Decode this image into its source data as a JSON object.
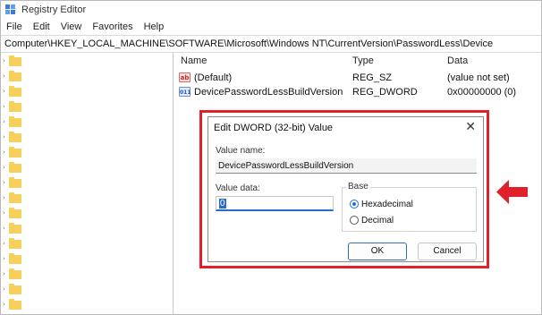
{
  "window": {
    "title": "Registry Editor",
    "app_icon": "registry-editor-icon"
  },
  "menu": [
    "File",
    "Edit",
    "View",
    "Favorites",
    "Help"
  ],
  "address": "Computer\\HKEY_LOCAL_MACHINE\\SOFTWARE\\Microsoft\\Windows NT\\CurrentVersion\\PasswordLess\\Device",
  "tree": {
    "row_count": 17,
    "folder_icon": "folder-icon",
    "expander_icon": "chevron-right-icon"
  },
  "list": {
    "columns": [
      "Name",
      "Type",
      "Data"
    ],
    "rows": [
      {
        "icon": "ab",
        "icon_name": "string-value-icon",
        "name": "(Default)",
        "type": "REG_SZ",
        "data": "(value not set)"
      },
      {
        "icon": "011",
        "icon_name": "dword-value-icon",
        "name": "DevicePasswordLessBuildVersion",
        "type": "REG_DWORD",
        "data": "0x00000000 (0)"
      }
    ]
  },
  "dialog": {
    "title": "Edit DWORD (32-bit) Value",
    "close": "✕",
    "value_name_label": "Value name:",
    "value_name": "DevicePasswordLessBuildVersion",
    "value_data_label": "Value data:",
    "value_data": "0",
    "base_label": "Base",
    "base_options": [
      {
        "label": "Hexadecimal",
        "selected": true
      },
      {
        "label": "Decimal",
        "selected": false
      }
    ],
    "ok": "OK",
    "cancel": "Cancel"
  },
  "colors": {
    "highlight": "#e0202b",
    "accent": "#2a6bd0",
    "folder": "#f7cf5b"
  }
}
